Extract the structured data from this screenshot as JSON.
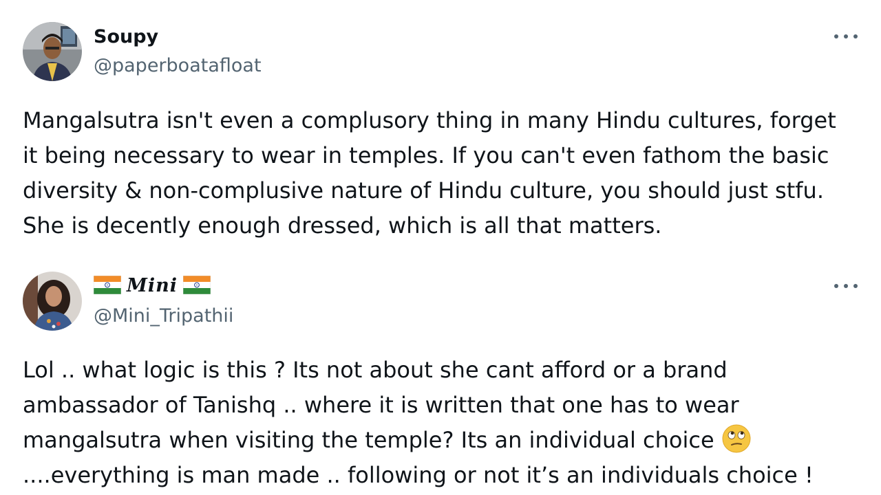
{
  "tweets": [
    {
      "author": {
        "display_name": "Soupy",
        "handle": "@paperboatafloat",
        "avatar_icon": "avatar-photo-man"
      },
      "more_icon": "more-options-icon",
      "text_lines": [
        "Mangalsutra isn't even a complusory thing in many Hindu cultures, forget",
        "it being necessary to wear in temples. If you can't even fathom the basic",
        "diversity & non-complusive nature of Hindu culture, you should just stfu.",
        "She is decently enough dressed, which is all that matters."
      ]
    },
    {
      "author": {
        "display_name": "Mini",
        "name_flag_icon": "india-flag-icon",
        "handle": "@Mini_Tripathii",
        "avatar_icon": "avatar-photo-woman"
      },
      "more_icon": "more-options-icon",
      "text_lines": [
        "Lol .. what logic is this ? Its not about she cant afford or a brand",
        "ambassador of Tanishq .. where it is written that one has to wear",
        "mangalsutra when visiting the temple?  Its an individual choice",
        "....everything is man made .. following or not it’s an  individuals choice !"
      ],
      "emoji_icon": "face-with-rolling-eyes-emoji"
    }
  ],
  "colors": {
    "text_primary": "#0f1419",
    "text_secondary": "#536471",
    "background": "#ffffff"
  }
}
